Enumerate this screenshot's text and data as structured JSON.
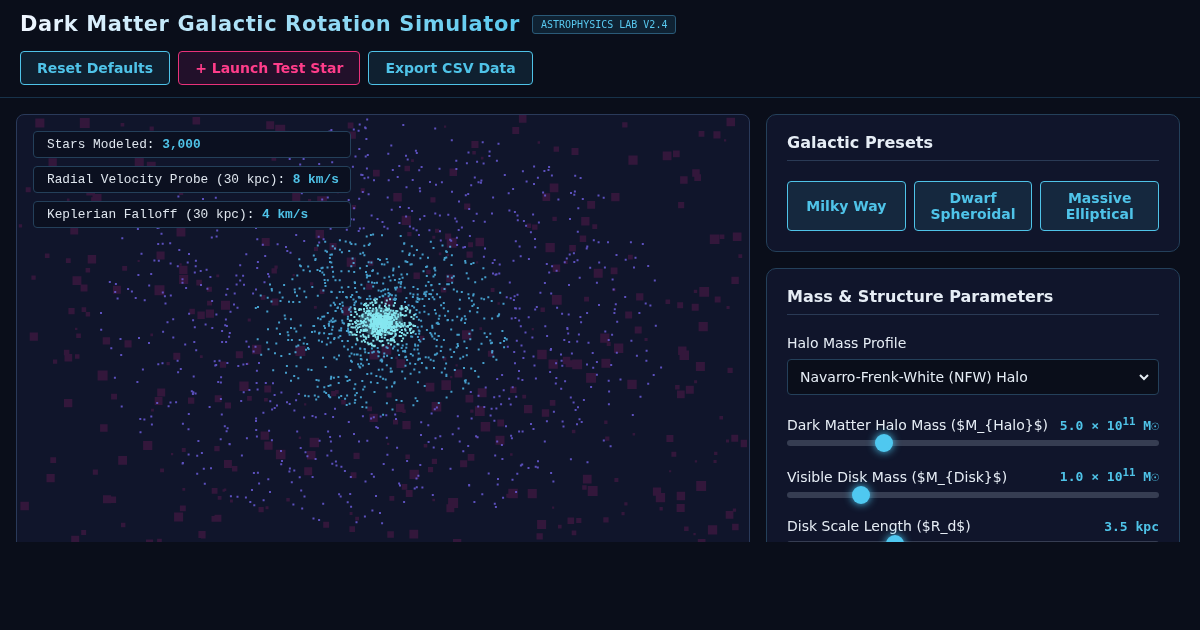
{
  "header": {
    "title": "Dark Matter Galactic Rotation Simulator",
    "badge": "ASTROPHYSICS LAB V2.4"
  },
  "actions": [
    {
      "label": "Reset Defaults",
      "kind": "normal"
    },
    {
      "label": "+ Launch Test Star",
      "kind": "accent"
    },
    {
      "label": "Export CSV Data",
      "kind": "normal"
    }
  ],
  "simulation": {
    "readouts": [
      {
        "label": "Stars Modeled:",
        "value": "3,000"
      },
      {
        "label": "Radial Velocity Probe (30 kpc):",
        "value": "8 km/s"
      },
      {
        "label": "Keplerian Falloff (30 kpc):",
        "value": "4 km/s"
      }
    ]
  },
  "presets": {
    "title": "Galactic Presets",
    "buttons": [
      "Milky Way",
      "Dwarf Spheroidal",
      "Massive Elliptical"
    ]
  },
  "parameters": {
    "title": "Mass & Structure Parameters",
    "profile": {
      "label": "Halo Mass Profile",
      "value": "Navarro-Frenk-White (NFW) Halo"
    },
    "sliders": [
      {
        "label": "Dark Matter Halo Mass ($M_{Halo}$)",
        "reading": "5.0 × 10$^{11}$ M☉",
        "level": 0.26
      },
      {
        "label": "Visible Disk Mass ($M_{Disk}$)",
        "reading": "1.0 × 10$^{11}$ M☉",
        "level": 0.2
      },
      {
        "label": "Disk Scale Length ($R_d$)",
        "reading": "3.5 kpc",
        "level": 0.29
      }
    ]
  }
}
